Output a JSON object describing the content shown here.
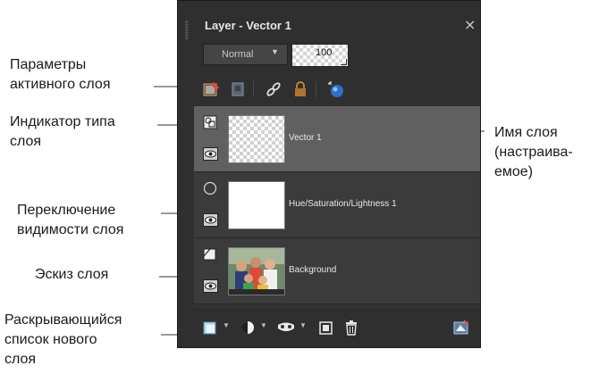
{
  "panel": {
    "title": "Layer - Vector 1",
    "close_glyph": "×",
    "blend_mode": "Normal",
    "opacity": "100",
    "toolbar_icons": [
      "layer-properties-icon",
      "lock-transparent-icon",
      "link-icon",
      "lock-icon",
      "layer-style-icon"
    ],
    "layers": [
      {
        "name": "Vector 1",
        "type_icon": "vector-layer-icon",
        "visible": true,
        "selected": true
      },
      {
        "name": "Hue/Saturation/Lightness 1",
        "type_icon": "adjustment-layer-icon",
        "visible": true,
        "selected": false
      },
      {
        "name": "Background",
        "type_icon": "raster-layer-icon",
        "visible": true,
        "selected": false
      }
    ],
    "bottom_icons": [
      "new-layer-icon",
      "new-adjustment-layer-icon",
      "new-mask-layer-icon",
      "new-group-icon",
      "delete-icon",
      "layer-effects-icon"
    ]
  },
  "callouts": {
    "active_params": [
      "Параметры",
      "активного слоя"
    ],
    "type_indicator": [
      "Индикатор типа",
      "слоя"
    ],
    "visibility": [
      "Переключение",
      "видимости слоя"
    ],
    "thumbnail": [
      "Эскиз слоя"
    ],
    "new_layer_dropdown": [
      "Раскрывающийся",
      "список нового",
      "слоя"
    ],
    "layer_name": [
      "Имя слоя",
      "(настраива-",
      "емое)"
    ]
  },
  "colors": {
    "panel_bg": "#2f2f2f",
    "selected_layer": "#606060",
    "callout_line": "#999999"
  }
}
